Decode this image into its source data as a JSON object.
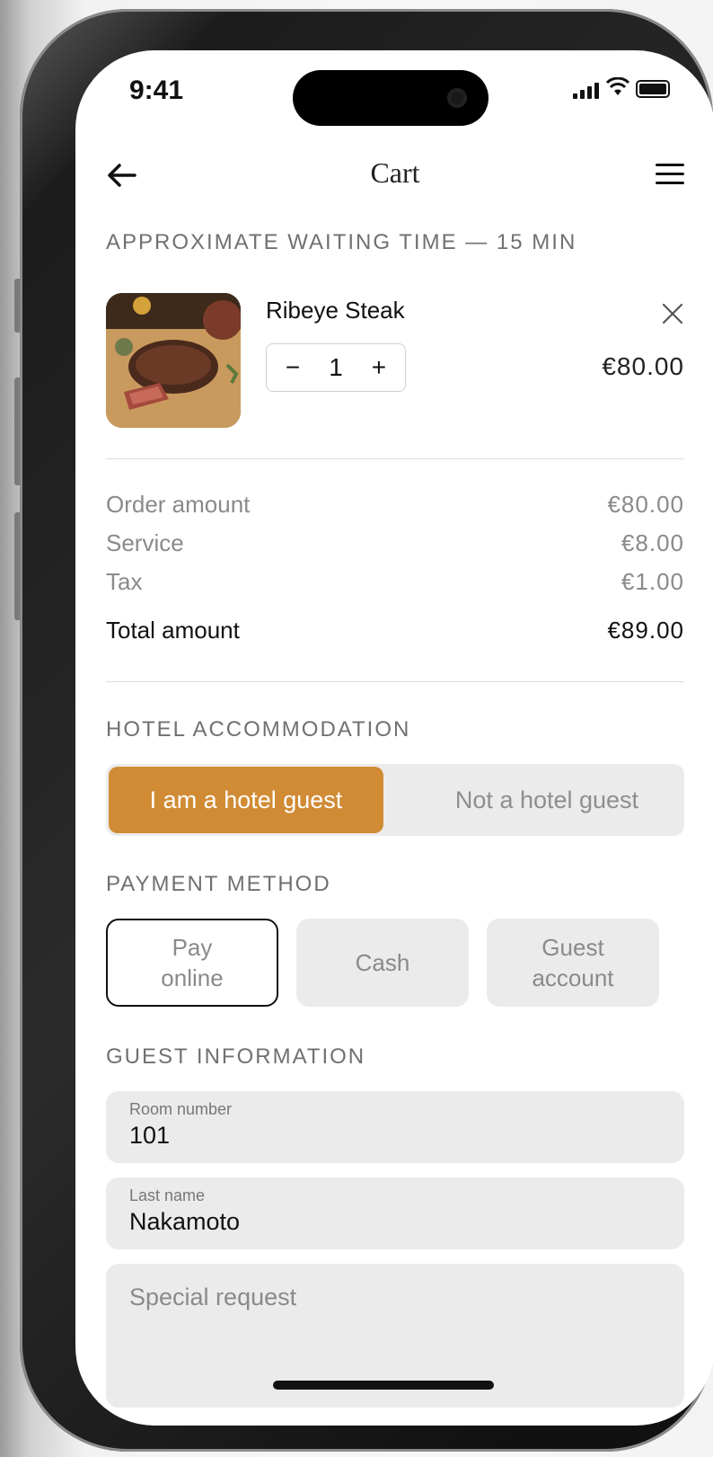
{
  "status_bar": {
    "time": "9:41"
  },
  "header": {
    "title": "Cart"
  },
  "waiting_time": "APPROXIMATE WAITING TIME — 15 MIN",
  "cart_item": {
    "name": "Ribeye Steak",
    "quantity": "1",
    "minus": "−",
    "plus": "+",
    "price": "€80.00"
  },
  "summary": [
    {
      "label": "Order amount",
      "value": "€80.00"
    },
    {
      "label": "Service",
      "value": "€8.00"
    },
    {
      "label": "Tax",
      "value": "€1.00"
    }
  ],
  "total": {
    "label": "Total amount",
    "value": "€89.00"
  },
  "accommodation": {
    "heading": "HOTEL ACCOMMODATION",
    "options": [
      "I am a hotel guest",
      "Not a hotel guest"
    ],
    "selected_color": "#d18b34"
  },
  "payment": {
    "heading": "PAYMENT METHOD",
    "options": [
      {
        "label": "Pay\nonline"
      },
      {
        "label": "Cash"
      },
      {
        "label": "Guest\naccount"
      }
    ]
  },
  "guest_info": {
    "heading": "GUEST INFORMATION",
    "room": {
      "label": "Room number",
      "value": "101"
    },
    "last_name": {
      "label": "Last name",
      "value": "Nakamoto"
    },
    "special_request": {
      "placeholder": "Special request"
    }
  }
}
